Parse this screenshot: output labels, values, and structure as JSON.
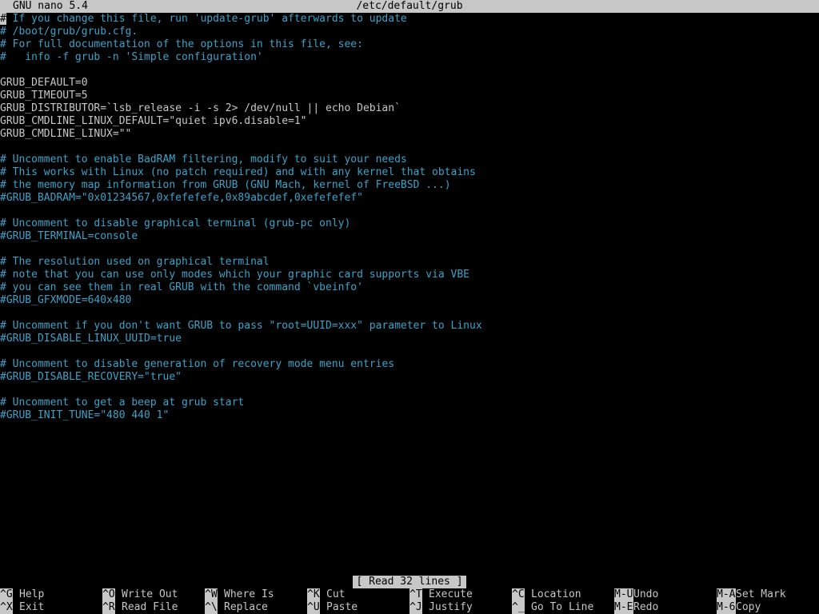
{
  "app": {
    "name": "GNU nano 5.4",
    "filename": "/etc/default/grub"
  },
  "editor": {
    "cursor_char": "#",
    "lines": [
      {
        "text": "# If you change this file, run 'update-grub' afterwards to update",
        "kind": "comment"
      },
      {
        "text": "# /boot/grub/grub.cfg.",
        "kind": "comment"
      },
      {
        "text": "# For full documentation of the options in this file, see:",
        "kind": "comment"
      },
      {
        "text": "#   info -f grub -n 'Simple configuration'",
        "kind": "comment"
      },
      {
        "text": "",
        "kind": "code"
      },
      {
        "text": "GRUB_DEFAULT=0",
        "kind": "code"
      },
      {
        "text": "GRUB_TIMEOUT=5",
        "kind": "code"
      },
      {
        "text": "GRUB_DISTRIBUTOR=`lsb_release -i -s 2> /dev/null || echo Debian`",
        "kind": "code"
      },
      {
        "text": "GRUB_CMDLINE_LINUX_DEFAULT=\"quiet ipv6.disable=1\"",
        "kind": "code"
      },
      {
        "text": "GRUB_CMDLINE_LINUX=\"\"",
        "kind": "code"
      },
      {
        "text": "",
        "kind": "code"
      },
      {
        "text": "# Uncomment to enable BadRAM filtering, modify to suit your needs",
        "kind": "comment"
      },
      {
        "text": "# This works with Linux (no patch required) and with any kernel that obtains",
        "kind": "comment"
      },
      {
        "text": "# the memory map information from GRUB (GNU Mach, kernel of FreeBSD ...)",
        "kind": "comment"
      },
      {
        "text": "#GRUB_BADRAM=\"0x01234567,0xfefefefe,0x89abcdef,0xefefefef\"",
        "kind": "comment"
      },
      {
        "text": "",
        "kind": "code"
      },
      {
        "text": "# Uncomment to disable graphical terminal (grub-pc only)",
        "kind": "comment"
      },
      {
        "text": "#GRUB_TERMINAL=console",
        "kind": "comment"
      },
      {
        "text": "",
        "kind": "code"
      },
      {
        "text": "# The resolution used on graphical terminal",
        "kind": "comment"
      },
      {
        "text": "# note that you can use only modes which your graphic card supports via VBE",
        "kind": "comment"
      },
      {
        "text": "# you can see them in real GRUB with the command `vbeinfo'",
        "kind": "comment"
      },
      {
        "text": "#GRUB_GFXMODE=640x480",
        "kind": "comment"
      },
      {
        "text": "",
        "kind": "code"
      },
      {
        "text": "# Uncomment if you don't want GRUB to pass \"root=UUID=xxx\" parameter to Linux",
        "kind": "comment"
      },
      {
        "text": "#GRUB_DISABLE_LINUX_UUID=true",
        "kind": "comment"
      },
      {
        "text": "",
        "kind": "code"
      },
      {
        "text": "# Uncomment to disable generation of recovery mode menu entries",
        "kind": "comment"
      },
      {
        "text": "#GRUB_DISABLE_RECOVERY=\"true\"",
        "kind": "comment"
      },
      {
        "text": "",
        "kind": "code"
      },
      {
        "text": "# Uncomment to get a beep at grub start",
        "kind": "comment"
      },
      {
        "text": "#GRUB_INIT_TUNE=\"480 440 1\"",
        "kind": "comment"
      }
    ]
  },
  "status": "[ Read 32 lines ]",
  "shortcuts": [
    {
      "key": "^G",
      "label": "Help"
    },
    {
      "key": "^X",
      "label": "Exit"
    },
    {
      "key": "^O",
      "label": "Write Out"
    },
    {
      "key": "^R",
      "label": "Read File"
    },
    {
      "key": "^W",
      "label": "Where Is"
    },
    {
      "key": "^\\",
      "label": "Replace"
    },
    {
      "key": "^K",
      "label": "Cut"
    },
    {
      "key": "^U",
      "label": "Paste"
    },
    {
      "key": "^T",
      "label": "Execute"
    },
    {
      "key": "^J",
      "label": "Justify"
    },
    {
      "key": "^C",
      "label": "Location"
    },
    {
      "key": "^_",
      "label": "Go To Line"
    },
    {
      "key": "M-U",
      "label": "Undo"
    },
    {
      "key": "M-E",
      "label": "Redo"
    },
    {
      "key": "M-A",
      "label": "Set Mark"
    },
    {
      "key": "M-6",
      "label": "Copy"
    }
  ],
  "colors": {
    "background": "#000000",
    "text": "#c7c7c7",
    "comment": "#3aa3c9",
    "bar": "#c7c7c7"
  }
}
